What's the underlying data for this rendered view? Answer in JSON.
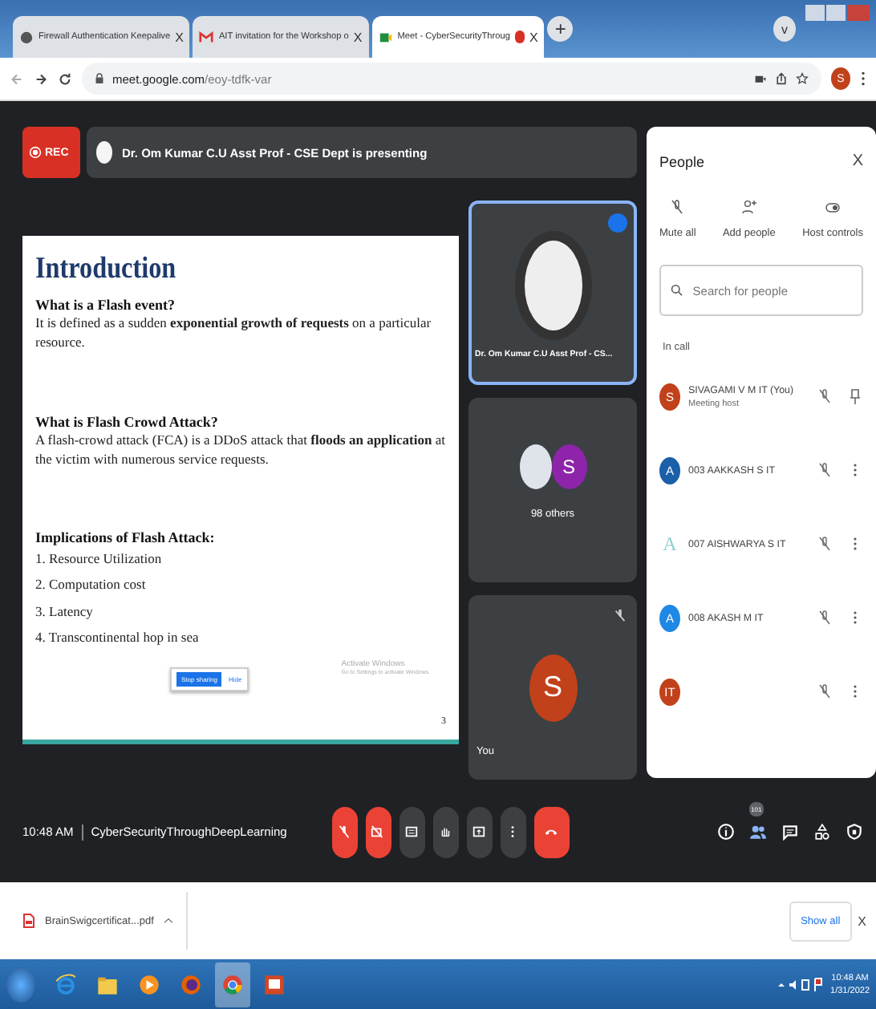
{
  "browser": {
    "tabs": [
      {
        "title": "Firewall Authentication Keepalive",
        "kind": "globe",
        "selected": false,
        "recording": false,
        "close": "X"
      },
      {
        "title": "AIT invitation for the Workshop o",
        "kind": "mail",
        "selected": false,
        "recording": false,
        "close": "X"
      },
      {
        "title": "Meet - CyberSecurityThroug",
        "kind": "meet",
        "selected": true,
        "recording": true,
        "close": "X"
      }
    ],
    "new_tab": "+",
    "tab_menu": "v",
    "url_host": "meet.google.com",
    "url_path": "/eoy-tdfk-var",
    "profile": "S"
  },
  "meet": {
    "rec": "REC",
    "presenting": "Dr. Om Kumar C.U Asst Prof - CSE Dept is presenting",
    "slide": {
      "title": "Introduction",
      "sections": [
        {
          "heading": "What is a Flash event?",
          "text": "It is defined as a sudden **exponential growth of requests** on a particular resource."
        },
        {
          "heading": "What is Flash Crowd Attack?",
          "text": "A flash-crowd attack (FCA) is a DDoS attack that **floods an application** at the victim with numerous service requests."
        },
        {
          "heading": "Implications of Flash Attack:",
          "list": [
            "1.  Resource Utilization",
            "2.  Computation cost",
            "3.  Latency",
            "4.  Transcontinental hop in sea"
          ]
        }
      ],
      "share_bar": {
        "stop": "Stop sharing",
        "hide": "Hide"
      },
      "activate": "Activate Windows",
      "activate_hint": "Go to Settings to activate Windows.",
      "page": "3"
    },
    "tiles": [
      {
        "kind": "speaker",
        "name": "Dr. Om Kumar C.U Asst Prof - CS...",
        "speaking": true
      },
      {
        "kind": "group",
        "name": "98 others",
        "letter": "S"
      },
      {
        "kind": "self",
        "name": "You",
        "letter": "S",
        "muted": true
      }
    ],
    "people": {
      "title": "People",
      "close": "X",
      "actions": [
        {
          "kind": "mute",
          "label": "Mute all"
        },
        {
          "kind": "add",
          "label": "Add people"
        },
        {
          "kind": "host",
          "label": "Host controls"
        }
      ],
      "search": {
        "placeholder": "Search for people"
      },
      "section": "In call",
      "participants": [
        {
          "letter": "S",
          "color": "#c1411b",
          "kind": "initial",
          "name": "SIVAGAMI V M IT (You)",
          "role": "Meeting host",
          "pinned": true
        },
        {
          "letter": "A",
          "color": "#1a5fa8",
          "kind": "initial",
          "name": "003 AAKKASH S IT",
          "pinned": false
        },
        {
          "letter": "A",
          "color": "#8ecfd0",
          "kind": "picture",
          "name": "007 AISHWARYA S IT",
          "pinned": false
        },
        {
          "letter": "A",
          "color": "#1e88e5",
          "kind": "initial",
          "name": "008 AKASH M IT",
          "pinned": false
        },
        {
          "letter": "IT",
          "color": "#c1411b",
          "kind": "initial",
          "pinned": false
        }
      ]
    },
    "time": "10:48 AM",
    "meeting": "CyberSecurityThroughDeepLearning",
    "controls": [
      {
        "kind": "mic",
        "alert": true
      },
      {
        "kind": "camera",
        "alert": true
      },
      {
        "kind": "captions",
        "alert": false
      },
      {
        "kind": "hand",
        "alert": false
      },
      {
        "kind": "present",
        "alert": false
      },
      {
        "kind": "more",
        "alert": false
      },
      {
        "kind": "end",
        "alert": true
      }
    ],
    "side_controls": [
      {
        "kind": "info",
        "selected": false
      },
      {
        "kind": "people",
        "selected": true,
        "badge": "101"
      },
      {
        "kind": "chat",
        "selected": false
      },
      {
        "kind": "activities",
        "selected": false
      },
      {
        "kind": "host",
        "selected": false
      }
    ]
  },
  "downloads": {
    "file": "BrainSwigcertificat...pdf",
    "show_all": "Show all",
    "close": "X"
  },
  "taskbar": {
    "apps": [
      {
        "kind": "ie",
        "selected": false
      },
      {
        "kind": "folder",
        "selected": false
      },
      {
        "kind": "media",
        "selected": false
      },
      {
        "kind": "firefox",
        "selected": false
      },
      {
        "kind": "chrome",
        "selected": true
      },
      {
        "kind": "slides",
        "selected": false
      }
    ],
    "time": "10:48 AM",
    "date": "1/31/2022"
  }
}
